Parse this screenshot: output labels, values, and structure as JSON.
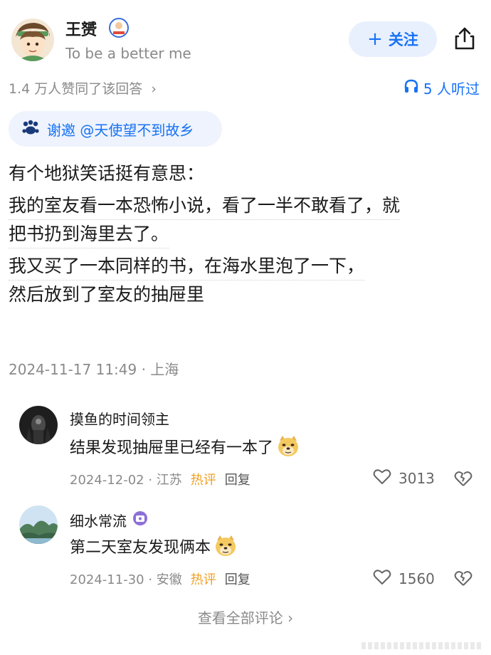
{
  "author": {
    "name": "王赟",
    "bio": "To be a better me"
  },
  "actions": {
    "follow_plus": "+",
    "follow_label": "关注"
  },
  "stats": {
    "agree": "1.4 万人赞同了该回答",
    "agree_chevron": "›",
    "listeners": "5 人听过"
  },
  "invite": {
    "text": "谢邀 @天使望不到故乡"
  },
  "answer": {
    "lines": [
      "有个地狱笑话挺有意思：",
      "我的室友看一本恐怖小说，看了一半不敢看了，就",
      "把书扔到海里去了。",
      "我又买了一本同样的书，在海水里泡了一下，",
      "然后放到了室友的抽屉里"
    ]
  },
  "post_meta": "2024-11-17 11:49 · 上海",
  "comments": [
    {
      "name": "摸鱼的时间领主",
      "text": "结果发现抽屉里已经有一本了",
      "date": "2024-12-02 · 江苏",
      "hot": "热评",
      "reply": "回复",
      "likes": "3013"
    },
    {
      "name": "细水常流",
      "text": "第二天室友发现俩本",
      "date": "2024-11-30 · 安徽",
      "hot": "热评",
      "reply": "回复",
      "likes": "1560"
    }
  ],
  "view_all": "查看全部评论 ›",
  "colors": {
    "accent": "#1772f6",
    "hot": "#f0a023",
    "muted": "#8a8a8a"
  }
}
